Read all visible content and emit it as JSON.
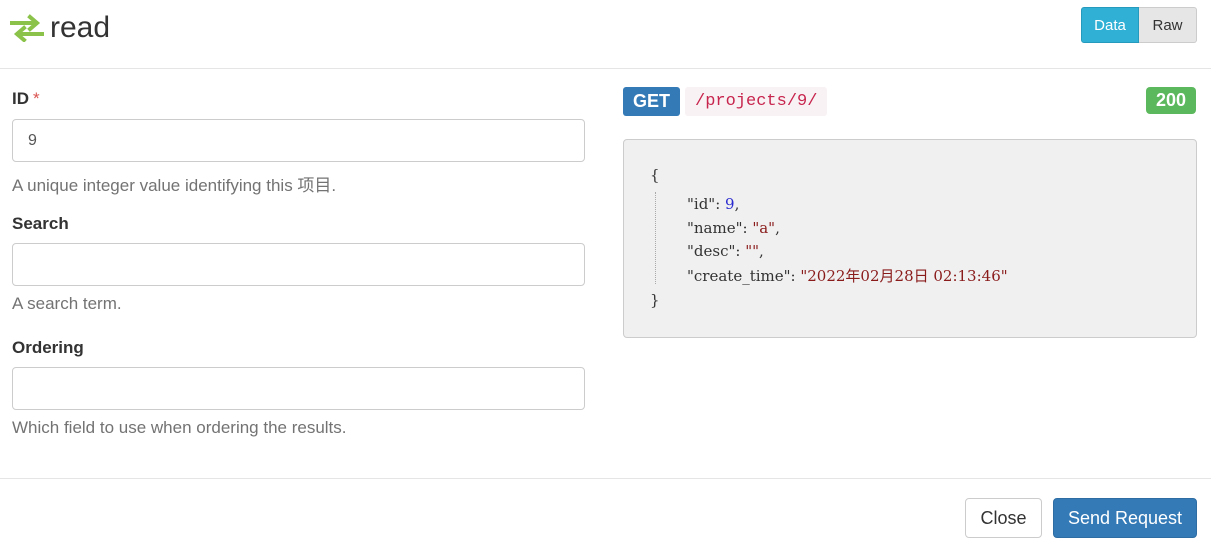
{
  "header": {
    "title": "read",
    "icon": "swap-arrows-icon",
    "accent_color": "#8bc34a",
    "tabs": [
      {
        "label": "Data",
        "active": true
      },
      {
        "label": "Raw",
        "active": false
      }
    ]
  },
  "form": {
    "id": {
      "label": "ID",
      "required_mark": "*",
      "value": "9",
      "help": "A unique integer value identifying this 项目."
    },
    "search": {
      "label": "Search",
      "value": "",
      "help": "A search term."
    },
    "ordering": {
      "label": "Ordering",
      "value": "",
      "help": "Which field to use when ordering the results."
    }
  },
  "response": {
    "method": "GET",
    "path": "/projects/9/",
    "status": "200",
    "open_brace": "{",
    "close_brace": "}",
    "fields": [
      {
        "key": "\"id\"",
        "sep": ": ",
        "value": "9",
        "type": "number",
        "trail": ","
      },
      {
        "key": "\"name\"",
        "sep": ": ",
        "value": "\"a\"",
        "type": "string",
        "trail": ","
      },
      {
        "key": "\"desc\"",
        "sep": ": ",
        "value": "\"\"",
        "type": "string",
        "trail": ","
      },
      {
        "key": "\"create_time\"",
        "sep": ": ",
        "value": "\"2022年02月28日 02:13:46\"",
        "type": "string",
        "trail": ""
      }
    ]
  },
  "footer": {
    "close_label": "Close",
    "send_label": "Send Request"
  }
}
